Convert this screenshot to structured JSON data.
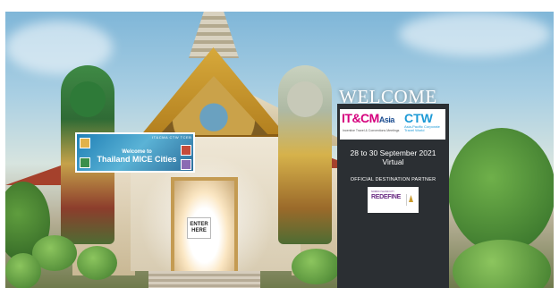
{
  "banner": {
    "logos": "IT&CMA CTW TCEB",
    "line1": "Welcome to",
    "line2": "Thailand MICE Cities"
  },
  "enter": {
    "line1": "ENTER",
    "line2": "HERE"
  },
  "welcome": {
    "heading": "WELCOME"
  },
  "panel": {
    "logo_itcma_main": "IT&CM",
    "logo_itcma_suffix": "Asia",
    "logo_itcma_sub": "Incentive Travel & Conventions Meetings",
    "logo_ctw_main": "CTW",
    "logo_ctw_sub": "Asia-Pacific Corporate Travel World",
    "date_line": "28 to 30 September 2021",
    "mode_line": "Virtual",
    "partner_label": "OFFICIAL DESTINATION PARTNER",
    "partner_top": "NORDIC ISLAND CITY",
    "partner_logo": "REDEFINE"
  },
  "colors": {
    "panel_bg": "#2b2f33",
    "itcma_magenta": "#d5007d",
    "itcma_blue": "#1d4e91",
    "ctw_blue": "#1e9ad6",
    "redefine_purple": "#6a2b83"
  }
}
